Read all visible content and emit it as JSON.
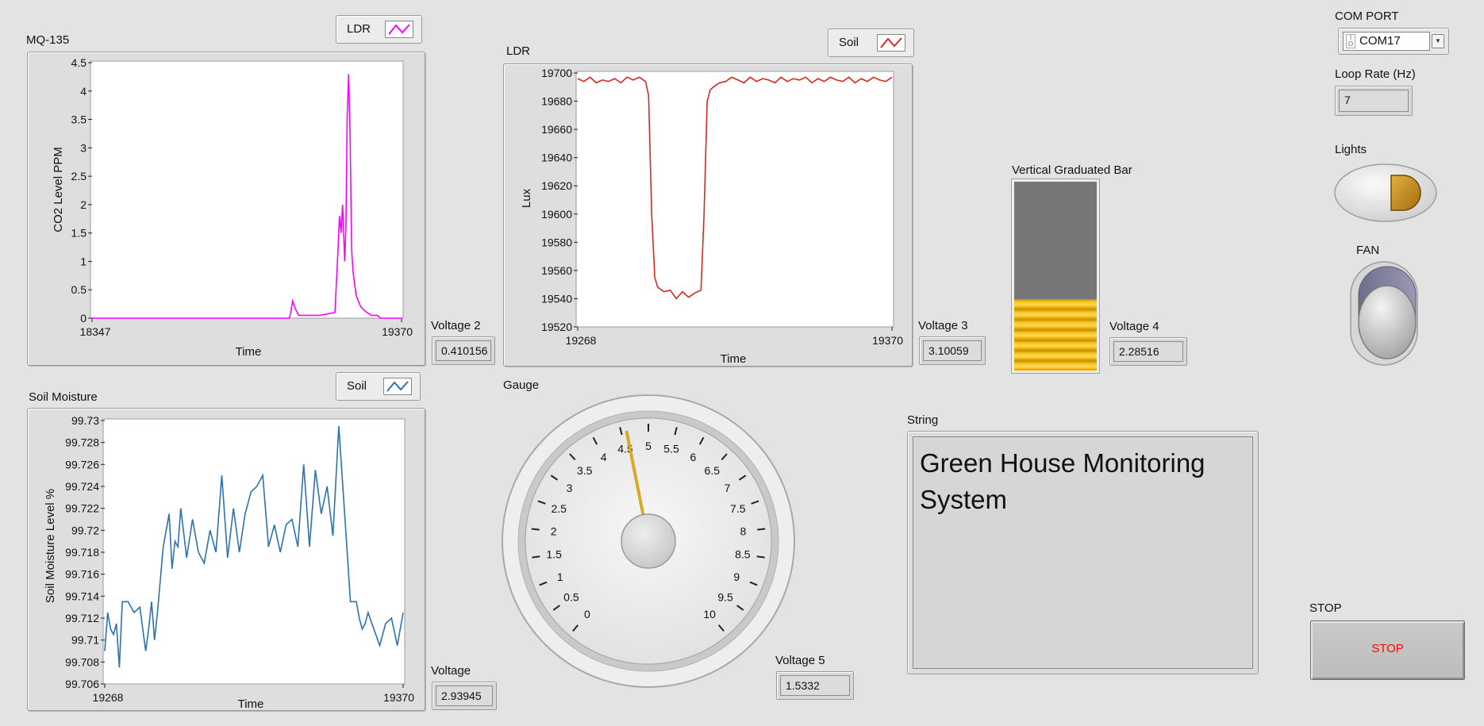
{
  "colors": {
    "background": "#e3e3e3",
    "mq135_line": "#ff00ff",
    "ldr_line": "#d42a22",
    "soil_line": "#2b72b2",
    "bar_fill": "#f2b705",
    "gauge_needle": "#d8a82a",
    "stop_text": "#ff0000",
    "lights_led": "#c8901e"
  },
  "mq135": {
    "title": "MQ-135",
    "legend": "LDR",
    "legend_icon": "line-plot-icon",
    "xlabel": "Time",
    "ylabel": "CO2 Level PPM",
    "x_ticks": [
      "18347",
      "19370"
    ],
    "y_ticks": [
      "0",
      "0.5",
      "1",
      "1.5",
      "2",
      "2.5",
      "3",
      "3.5",
      "4",
      "4.5"
    ]
  },
  "ldr": {
    "title": "LDR",
    "legend": "Soil",
    "legend_icon": "line-plot-icon",
    "xlabel": "Time",
    "ylabel": "Lux",
    "x_ticks": [
      "19268",
      "19370"
    ],
    "y_ticks": [
      "19520",
      "19540",
      "19560",
      "19580",
      "19600",
      "19620",
      "19640",
      "19660",
      "19680",
      "19700"
    ]
  },
  "soil": {
    "title": "Soil Moisture",
    "legend": "Soil",
    "legend_icon": "line-plot-icon",
    "xlabel": "Time",
    "ylabel": "Soil Moisture Level %",
    "x_ticks": [
      "19268",
      "19370"
    ],
    "y_ticks": [
      "99.706",
      "99.708",
      "99.71",
      "99.712",
      "99.714",
      "99.716",
      "99.718",
      "99.72",
      "99.722",
      "99.724",
      "99.726",
      "99.728",
      "99.73"
    ]
  },
  "chart_data": [
    {
      "type": "line",
      "title": "MQ-135",
      "xlabel": "Time",
      "ylabel": "CO2 Level PPM",
      "xlim": [
        18347,
        19370
      ],
      "ylim": [
        0,
        4.5
      ],
      "grid": false,
      "legend_placement": "top-right",
      "series": [
        {
          "name": "LDR",
          "x": [
            18347,
            18600,
            18900,
            19000,
            19010,
            19020,
            19030,
            19100,
            19150,
            19160,
            19165,
            19170,
            19175,
            19178,
            19182,
            19186,
            19190,
            19195,
            19200,
            19205,
            19210,
            19220,
            19235,
            19250,
            19270,
            19290,
            19300,
            19370
          ],
          "y": [
            0,
            0,
            0,
            0,
            0.3,
            0.15,
            0.05,
            0.05,
            0.1,
            1.2,
            1.8,
            1.5,
            2.0,
            1.6,
            1.0,
            1.6,
            3.5,
            4.3,
            3.2,
            1.2,
            0.8,
            0.4,
            0.2,
            0.12,
            0.05,
            0.05,
            0,
            0
          ]
        }
      ]
    },
    {
      "type": "line",
      "title": "LDR",
      "xlabel": "Time",
      "ylabel": "Lux",
      "xlim": [
        19268,
        19370
      ],
      "ylim": [
        19520,
        19700
      ],
      "grid": false,
      "legend_placement": "top-right",
      "series": [
        {
          "name": "Soil",
          "x": [
            19268,
            19270,
            19272,
            19274,
            19276,
            19278,
            19280,
            19282,
            19284,
            19286,
            19288,
            19290,
            19291,
            19292,
            19293,
            19294,
            19296,
            19298,
            19300,
            19302,
            19304,
            19306,
            19308,
            19309,
            19310,
            19311,
            19312,
            19314,
            19316,
            19318,
            19320,
            19322,
            19324,
            19326,
            19328,
            19330,
            19332,
            19334,
            19336,
            19338,
            19340,
            19342,
            19344,
            19346,
            19348,
            19350,
            19352,
            19354,
            19356,
            19358,
            19360,
            19362,
            19364,
            19366,
            19368,
            19370
          ],
          "y": [
            19696,
            19694,
            19697,
            19693,
            19695,
            19694,
            19696,
            19693,
            19697,
            19695,
            19697,
            19694,
            19684,
            19600,
            19555,
            19548,
            19545,
            19546,
            19540,
            19545,
            19541,
            19544,
            19546,
            19600,
            19680,
            19688,
            19690,
            19693,
            19694,
            19697,
            19695,
            19693,
            19697,
            19694,
            19696,
            19695,
            19693,
            19697,
            19694,
            19696,
            19695,
            19697,
            19693,
            19696,
            19694,
            19697,
            19695,
            19694,
            19697,
            19693,
            19696,
            19694,
            19697,
            19695,
            19694,
            19697
          ]
        }
      ]
    },
    {
      "type": "line",
      "title": "Soil Moisture",
      "xlabel": "Time",
      "ylabel": "Soil Moisture Level %",
      "xlim": [
        19268,
        19370
      ],
      "ylim": [
        99.706,
        99.73
      ],
      "grid": false,
      "legend_placement": "top-right",
      "series": [
        {
          "name": "Soil",
          "x": [
            19268,
            19269,
            19270,
            19271,
            19272,
            19273,
            19274,
            19276,
            19278,
            19280,
            19282,
            19283,
            19284,
            19285,
            19286,
            19288,
            19290,
            19291,
            19292,
            19293,
            19294,
            19296,
            19298,
            19300,
            19302,
            19304,
            19306,
            19308,
            19310,
            19312,
            19314,
            19316,
            19318,
            19320,
            19322,
            19324,
            19326,
            19328,
            19330,
            19332,
            19334,
            19336,
            19338,
            19340,
            19342,
            19344,
            19346,
            19348,
            19350,
            19352,
            19354,
            19355,
            19356,
            19357,
            19358,
            19360,
            19362,
            19364,
            19366,
            19368,
            19370
          ],
          "y": [
            99.709,
            99.7125,
            99.711,
            99.7105,
            99.7115,
            99.7075,
            99.7135,
            99.7135,
            99.7125,
            99.713,
            99.709,
            99.711,
            99.7135,
            99.71,
            99.7125,
            99.7185,
            99.7215,
            99.7165,
            99.719,
            99.7185,
            99.722,
            99.7175,
            99.721,
            99.718,
            99.717,
            99.72,
            99.718,
            99.725,
            99.7175,
            99.722,
            99.718,
            99.7215,
            99.7235,
            99.724,
            99.725,
            99.7185,
            99.7205,
            99.718,
            99.7205,
            99.721,
            99.7185,
            99.726,
            99.7185,
            99.7255,
            99.7215,
            99.724,
            99.7195,
            99.7295,
            99.7215,
            99.7135,
            99.7135,
            99.712,
            99.711,
            99.7115,
            99.7125,
            99.711,
            99.7095,
            99.7115,
            99.712,
            99.7095,
            99.7125
          ]
        }
      ]
    }
  ],
  "indicators": {
    "voltage2": {
      "label": "Voltage 2",
      "value": "0.410156"
    },
    "voltage3": {
      "label": "Voltage 3",
      "value": "3.10059"
    },
    "voltage4": {
      "label": "Voltage 4",
      "value": "2.28516"
    },
    "voltage": {
      "label": "Voltage",
      "value": "2.93945"
    },
    "voltage5": {
      "label": "Voltage 5",
      "value": "1.5332"
    }
  },
  "bar": {
    "label": "Vertical Graduated Bar",
    "fill_fraction": 0.38
  },
  "gauge": {
    "label": "Gauge",
    "min": 0,
    "max": 10,
    "value": 4.6,
    "tick_labels": [
      "0",
      "0.5",
      "1",
      "1.5",
      "2",
      "2.5",
      "3",
      "3.5",
      "4",
      "4.5",
      "5",
      "5.5",
      "6",
      "6.5",
      "7",
      "7.5",
      "8",
      "8.5",
      "9",
      "9.5",
      "10"
    ]
  },
  "string": {
    "label": "String",
    "text": "Green House Monitoring System"
  },
  "com_port": {
    "label": "COM PORT",
    "value": "COM17",
    "io_icon": "io-resource-icon",
    "dropdown_icon": "chevron-down-icon"
  },
  "loop_rate": {
    "label": "Loop Rate (Hz)",
    "value": "7"
  },
  "lights": {
    "label": "Lights",
    "state": "on"
  },
  "fan": {
    "label": "FAN",
    "state": "off"
  },
  "stop": {
    "label": "STOP",
    "button_text": "STOP"
  }
}
